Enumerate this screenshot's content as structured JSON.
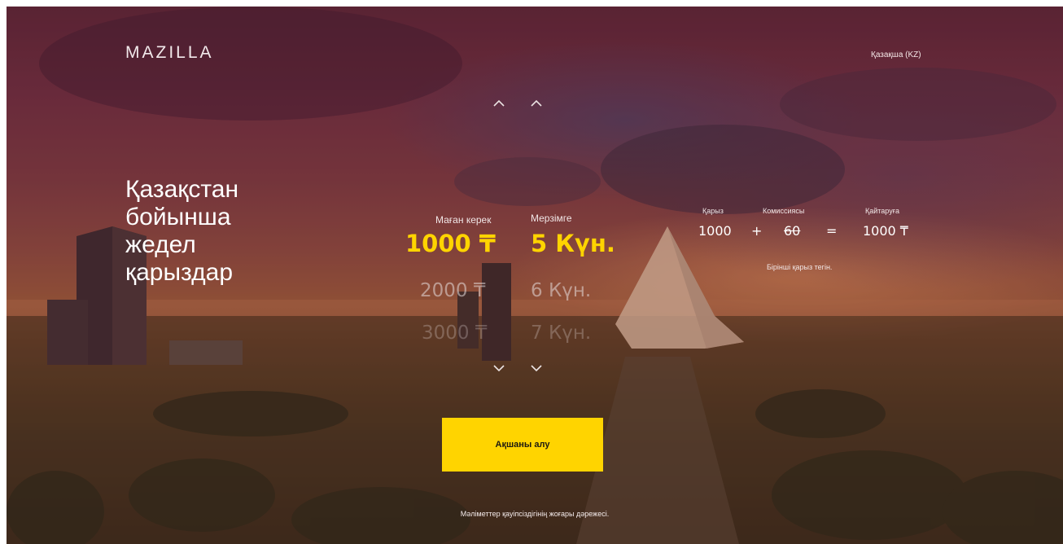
{
  "header": {
    "logo": "MAZILLA",
    "language": "Қазақша (KZ)"
  },
  "hero": {
    "headline_lines": [
      "Қазақстан",
      "бойынша",
      "жедел",
      "қарыздар"
    ]
  },
  "picker": {
    "amount": {
      "label": "Маған керек",
      "selected": "1000 ₸",
      "options": [
        "2000 ₸",
        "3000 ₸"
      ]
    },
    "term": {
      "label": "Мерзімге",
      "selected": "5 Күн.",
      "options": [
        "6 Күн.",
        "7 Күн."
      ]
    }
  },
  "calc": {
    "loan_label": "Қарыз",
    "loan_value": "1000",
    "plus": "+",
    "fee_label": "Комиссиясы",
    "fee_value": "60",
    "equals": "=",
    "return_label": "Қайтаруға",
    "return_value": "1000 ₸",
    "note": "Бірінші қарыз тегін."
  },
  "cta": {
    "label": "Ақшаны алу"
  },
  "footer": {
    "text": "Мәліметтер қауіпсіздігінің жоғары дәрежесі."
  },
  "colors": {
    "accent": "#ffd400",
    "overlay": "#6e2f3e"
  },
  "icons": {
    "chevron_up": "chevron-up-icon",
    "chevron_down": "chevron-down-icon"
  }
}
